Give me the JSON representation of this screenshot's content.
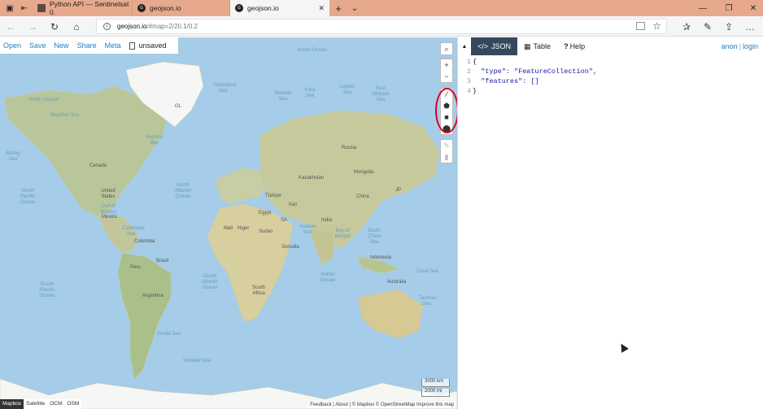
{
  "browser": {
    "tabs": [
      {
        "title": "Python API — Sentinelsat 0."
      },
      {
        "title": "geojson.io"
      },
      {
        "title": "geojson.io"
      }
    ],
    "url_host": "geojson.io",
    "url_path": "/#map=2/20.1/0.2"
  },
  "toolbar": {
    "open": "Open",
    "save": "Save",
    "new": "New",
    "share": "Share",
    "meta": "Meta",
    "status": "unsaved"
  },
  "map_controls": [
    "search-icon",
    "zoom-in-icon",
    "zoom-out-icon",
    "draw-line-icon",
    "draw-polygon-icon",
    "draw-rectangle-icon",
    "draw-marker-icon",
    "edit-icon",
    "delete-icon"
  ],
  "map_labels": {
    "arctic_ocean_top": "Arctic Ocean",
    "arctic_ocean_left": "Arctic Ocean",
    "gl": "GL",
    "beaufort_sea": "Beaufort Sea",
    "bering_sea": "Bering Sea",
    "hudson_bay": "Hudson Bay",
    "canada": "Canada",
    "united_states": "United States",
    "mexico": "Mexico",
    "north_pacific": "North Pacific Ocean",
    "north_atlantic": "North Atlantic Ocean",
    "south_pacific": "South Pacific Ocean",
    "south_atlantic": "South Atlantic Ocean",
    "indian_ocean": "Indian Ocean",
    "brasil": "Brasil",
    "peru": "Peru",
    "argentina": "Argentina",
    "colombia": "Colombia",
    "russia": "Russia",
    "china": "China",
    "india": "India",
    "kazakhstan": "Kazakhstan",
    "australia": "Australia",
    "coral_sea": "Coral Sea",
    "tasman_sea": "Tasman Sea",
    "scotia_sea": "Scotia Sea",
    "weddell_sea": "Weddell Sea",
    "greenland_sea": "Greenland Sea",
    "barents_sea": "Barents Sea",
    "kara_sea": "Kara Sea",
    "laptev_sea": "Laptev Sea",
    "east_siberian_sea": "East Siberian Sea",
    "south_china_sea": "South China Sea",
    "arabian_sea": "Arabian Sea",
    "bay_of_bengal": "Bay of Bengal",
    "caribbean_sea": "Caribbean Sea",
    "gulf_of_mexico": "Gulf of Mexico",
    "turkiye": "Türkiye",
    "iran": "Iran",
    "saudi": "SA",
    "niger": "Niger",
    "mali": "Mali",
    "egypt": "Egypt",
    "sudan": "Sudan",
    "somalia": "Somalia",
    "south_africa": "South Africa",
    "mongolia": "Mongolia",
    "japan": "JP",
    "indonesia": "Indonesia"
  },
  "scale": {
    "km": "3000 km",
    "mi": "2000 mi"
  },
  "attribution": "Feedback | About | © Mapbox © OpenStreetMap Improve this map",
  "layers": [
    "Mapbox",
    "Satellite",
    "OCM",
    "OSM"
  ],
  "panel": {
    "tabs": {
      "json": "JSON",
      "table": "Table",
      "help": "Help"
    },
    "auth": {
      "anon": "anon",
      "sep": "|",
      "login": "login"
    },
    "code": [
      {
        "n": "1",
        "t": "{"
      },
      {
        "n": "2",
        "t": "  \"type\": \"FeatureCollection\","
      },
      {
        "n": "3",
        "t": "  \"features\": []"
      },
      {
        "n": "4",
        "t": "}"
      }
    ]
  }
}
